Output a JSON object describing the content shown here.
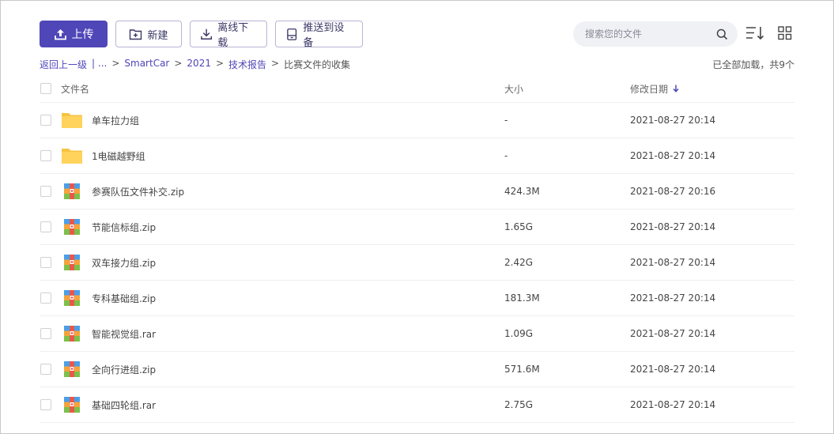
{
  "toolbar": {
    "upload_label": "上传",
    "new_label": "新建",
    "offline_label": "离线下载",
    "push_label": "推送到设备"
  },
  "search": {
    "placeholder": "搜索您的文件"
  },
  "breadcrumb": {
    "back": "返回上一级",
    "ellipsis": "| ...",
    "items": [
      "SmartCar",
      "2021",
      "技术报告"
    ],
    "current": "比赛文件的收集"
  },
  "summary": "已全部加载，共9个",
  "columns": {
    "name": "文件名",
    "size": "大小",
    "date": "修改日期"
  },
  "colors": {
    "accent": "#4f46b8",
    "folder": "#ffd35c"
  },
  "files": [
    {
      "name": "单车拉力组",
      "size": "-",
      "date": "2021-08-27 20:14",
      "type": "folder-icon"
    },
    {
      "name": "1电磁越野组",
      "size": "-",
      "date": "2021-08-27 20:14",
      "type": "folder-icon"
    },
    {
      "name": "参赛队伍文件补交.zip",
      "size": "424.3M",
      "date": "2021-08-27 20:16",
      "type": "archive-icon"
    },
    {
      "name": "节能信标组.zip",
      "size": "1.65G",
      "date": "2021-08-27 20:14",
      "type": "archive-icon"
    },
    {
      "name": "双车接力组.zip",
      "size": "2.42G",
      "date": "2021-08-27 20:14",
      "type": "archive-icon"
    },
    {
      "name": "专科基础组.zip",
      "size": "181.3M",
      "date": "2021-08-27 20:14",
      "type": "archive-icon"
    },
    {
      "name": "智能视觉组.rar",
      "size": "1.09G",
      "date": "2021-08-27 20:14",
      "type": "archive-icon"
    },
    {
      "name": "全向行进组.zip",
      "size": "571.6M",
      "date": "2021-08-27 20:14",
      "type": "archive-icon"
    },
    {
      "name": "基础四轮组.rar",
      "size": "2.75G",
      "date": "2021-08-27 20:14",
      "type": "archive-icon"
    }
  ]
}
